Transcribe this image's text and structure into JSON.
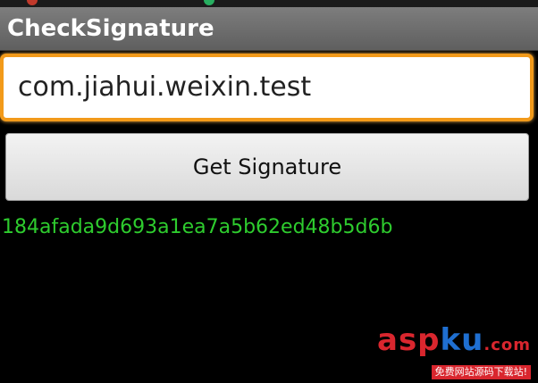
{
  "app": {
    "title": "CheckSignature"
  },
  "package_input": {
    "value": "com.jiahui.weixin.test"
  },
  "get_signature_button": {
    "label": "Get Signature"
  },
  "result": {
    "signature": "184afada9d693a1ea7a5b62ed48b5d6b"
  },
  "watermark": {
    "logo_part1": "asp",
    "logo_part2": "ku",
    "logo_part3": ".com",
    "tagline": "免费网站源码下载站!"
  },
  "colors": {
    "title_bar": "#6e6e6e",
    "input_focus_border": "#f29a1a",
    "signature_text": "#2ecc2e",
    "watermark_red": "#d9262e",
    "watermark_blue": "#1f6fd1"
  }
}
